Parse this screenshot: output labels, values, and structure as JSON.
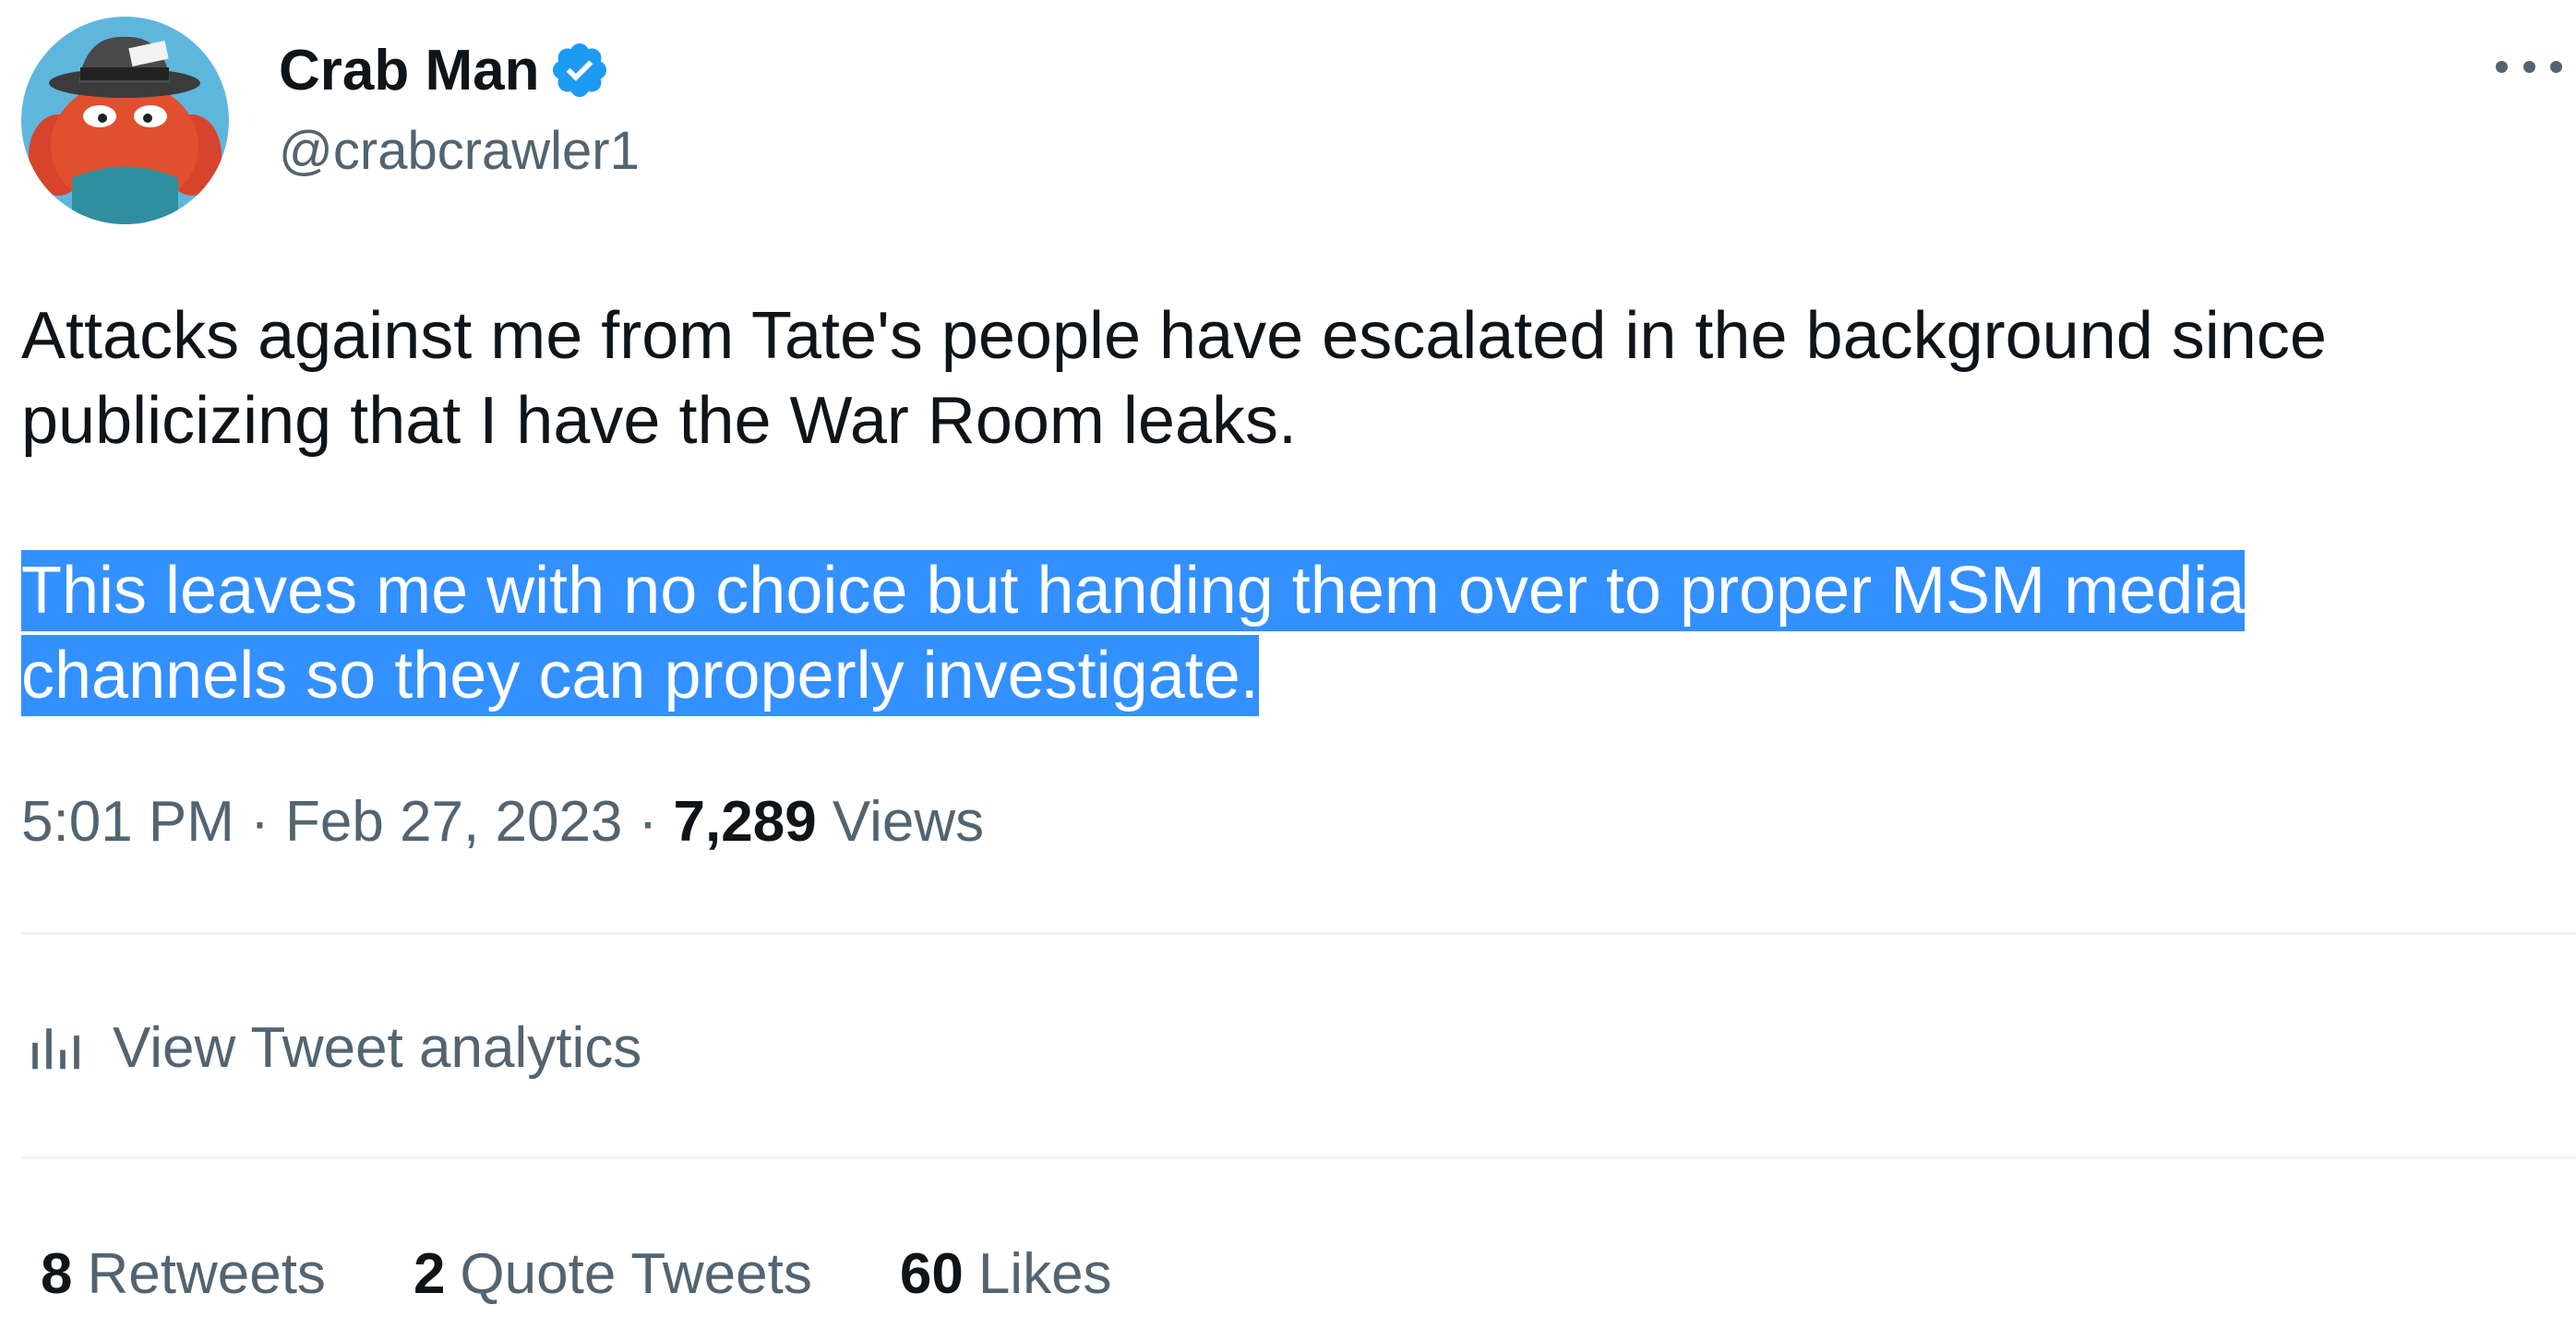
{
  "user": {
    "display_name": "Crab Man",
    "handle": "@crabcrawler1",
    "avatar_hat_text": "PRESS",
    "verified_icon": "verified-badge-icon"
  },
  "tweet": {
    "paragraph_1": "Attacks against me from Tate's people have escalated in the background since publicizing that I have the War Room leaks.",
    "paragraph_2_line_1": "This leaves me with no choice but handing them over to proper MSM media",
    "paragraph_2_line_2": "channels so they can properly investigate.",
    "highlight_color": "#3390ff"
  },
  "meta": {
    "time": "5:01 PM",
    "separator": " · ",
    "date": "Feb 27, 2023",
    "views_count": "7,289",
    "views_label": "Views"
  },
  "analytics": {
    "icon": "analytics-bars-icon",
    "label": "View Tweet analytics"
  },
  "stats": [
    {
      "count": "8",
      "label": "Retweets"
    },
    {
      "count": "2",
      "label": "Quote Tweets"
    },
    {
      "count": "60",
      "label": "Likes"
    }
  ],
  "colors": {
    "text_primary": "#0f1419",
    "text_secondary": "#536471",
    "verified_blue": "#1d9bf0",
    "divider": "#eff3f4"
  }
}
